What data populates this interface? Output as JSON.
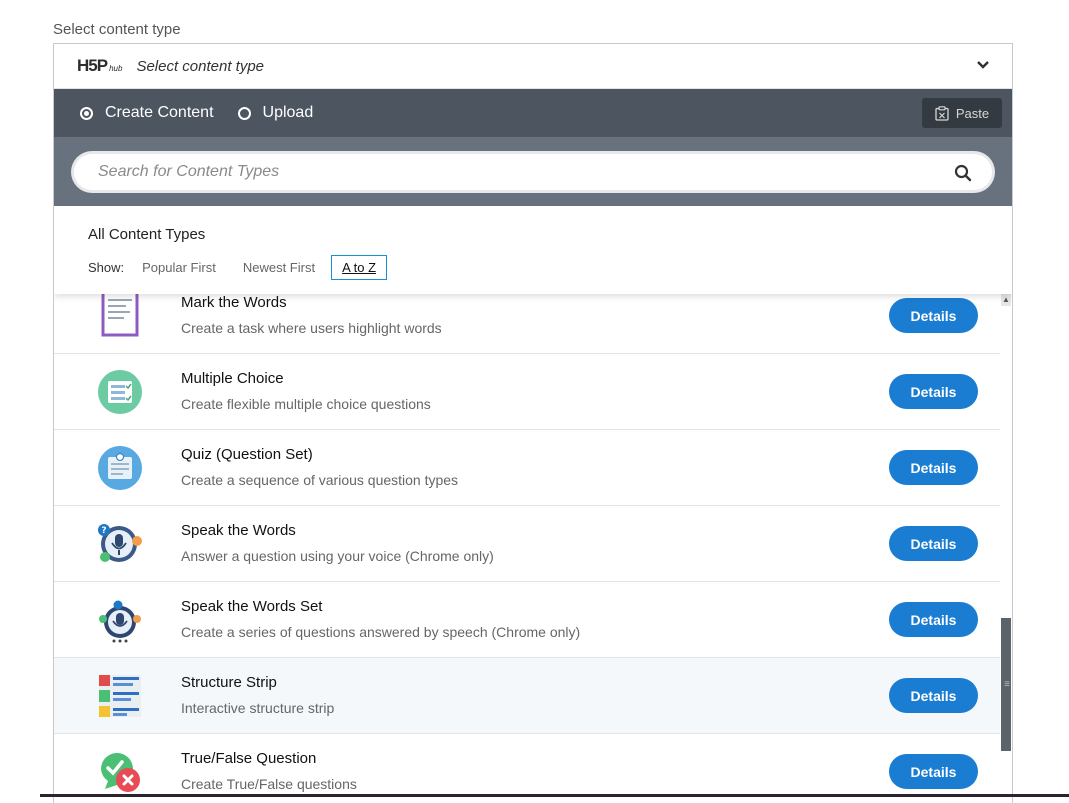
{
  "page": {
    "label": "Select content type"
  },
  "hub": {
    "logo_main": "H5P",
    "logo_sub": "hub",
    "title": "Select content type",
    "tabs": [
      {
        "label": "Create Content",
        "selected": true
      },
      {
        "label": "Upload",
        "selected": false
      }
    ],
    "paste_label": "Paste",
    "search_placeholder": "Search for Content Types",
    "section_title": "All Content Types",
    "show_label": "Show:",
    "sort_options": [
      {
        "label": "Popular First",
        "active": false
      },
      {
        "label": "Newest First",
        "active": false
      },
      {
        "label": "A to Z",
        "active": true
      }
    ],
    "details_label": "Details",
    "items": [
      {
        "name": "Mark the Words",
        "desc": "Create a task where users highlight words",
        "icon": "mark-the-words-icon"
      },
      {
        "name": "Multiple Choice",
        "desc": "Create flexible multiple choice questions",
        "icon": "multiple-choice-icon"
      },
      {
        "name": "Quiz (Question Set)",
        "desc": "Create a sequence of various question types",
        "icon": "question-set-icon"
      },
      {
        "name": "Speak the Words",
        "desc": "Answer a question using your voice (Chrome only)",
        "icon": "speak-the-words-icon"
      },
      {
        "name": "Speak the Words Set",
        "desc": "Create a series of questions answered by speech (Chrome only)",
        "icon": "speak-the-words-set-icon"
      },
      {
        "name": "Structure Strip",
        "desc": "Interactive structure strip",
        "icon": "structure-strip-icon"
      },
      {
        "name": "True/False Question",
        "desc": "Create True/False questions",
        "icon": "true-false-icon"
      }
    ]
  },
  "colors": {
    "tabbar": "#4c5560",
    "searchbar": "#68727e",
    "accent": "#1a7dd1"
  }
}
